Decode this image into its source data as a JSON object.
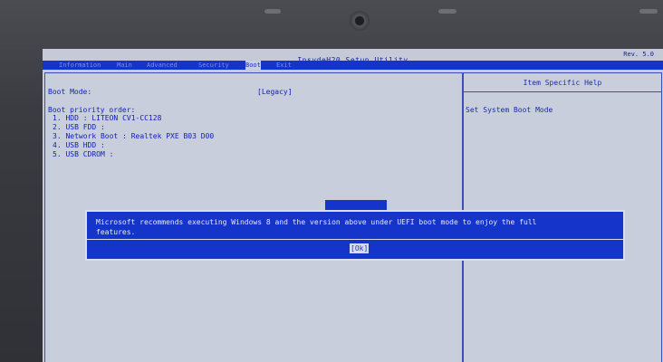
{
  "window": {
    "title": "InsydeH20 Setup Utility",
    "title_right": "Rev. 5.0"
  },
  "menu": {
    "tabs": [
      {
        "label": "Information"
      },
      {
        "label": "Main"
      },
      {
        "label": "Advanced"
      },
      {
        "label": "Security"
      },
      {
        "label": "Boot",
        "active": true
      },
      {
        "label": "Exit"
      }
    ]
  },
  "boot": {
    "mode_label": "Boot Mode:",
    "mode_value": "[Legacy]",
    "priority_label": "Boot priority order:",
    "items": [
      "1. HDD : LITEON CV1-CC128",
      "2. USB FDD :",
      "3. Network Boot : Realtek PXE B03 D00",
      "4. USB HDD :",
      "5. USB CDROM :"
    ]
  },
  "help": {
    "header": "Item Specific Help",
    "text": "Set System Boot Mode"
  },
  "dialog": {
    "message": "Microsoft recommends executing Windows 8 and the version above under UEFI boot mode to enjoy the full\nfeatures.",
    "ok_label": "[Ok]"
  },
  "colors": {
    "screen_bg": "#c7ccdc",
    "accent_blue": "#1534c9",
    "text_blue": "#1020b8"
  }
}
